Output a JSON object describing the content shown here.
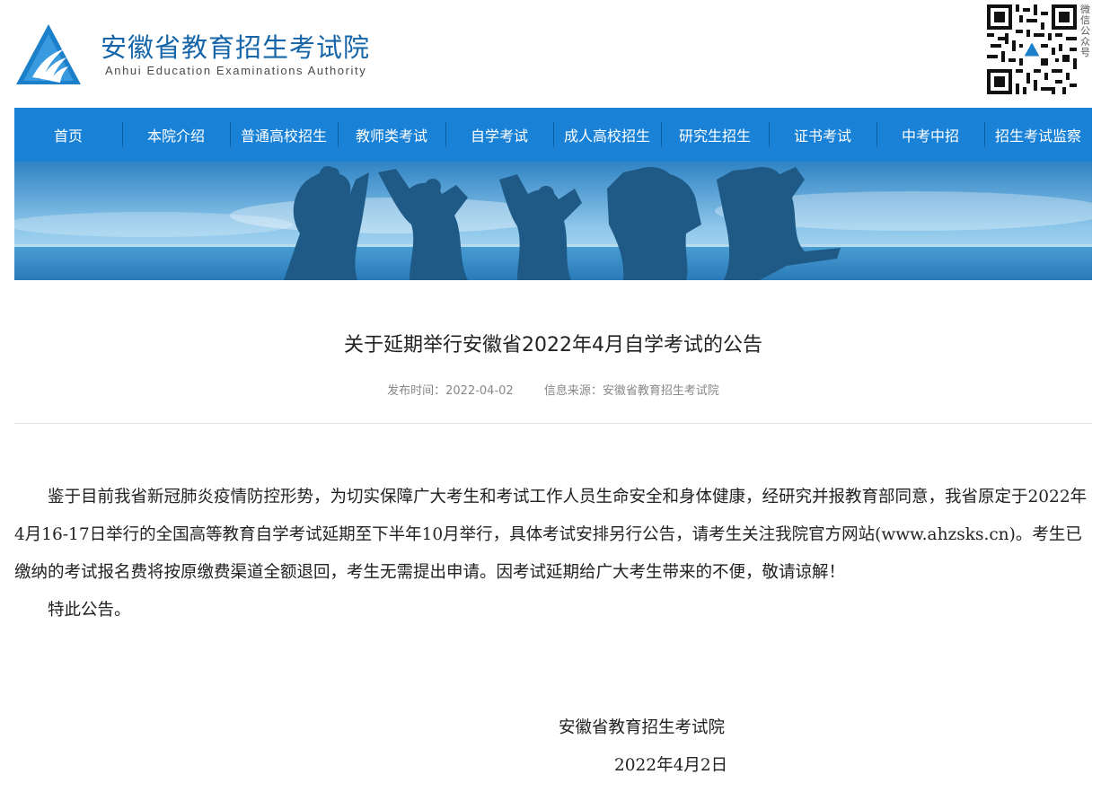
{
  "header": {
    "title": "安徽省教育招生考试院",
    "subtitle": "Anhui Education Examinations Authority",
    "qr_label": "微信公众号"
  },
  "colors": {
    "brand_blue": "#1565a8",
    "nav_blue": "#1a82d6",
    "text": "#222222",
    "meta": "#888888"
  },
  "icons": {
    "logo": "triangle-flame-logo-icon",
    "qr": "wechat-qr-code-icon"
  },
  "nav": {
    "items": [
      {
        "label": "首页"
      },
      {
        "label": "本院介绍"
      },
      {
        "label": "普通高校招生"
      },
      {
        "label": "教师类考试"
      },
      {
        "label": "自学考试"
      },
      {
        "label": "成人高校招生"
      },
      {
        "label": "研究生招生"
      },
      {
        "label": "证书考试"
      },
      {
        "label": "中考中招"
      },
      {
        "label": "招生考试监察"
      }
    ]
  },
  "article": {
    "title": "关于延期举行安徽省2022年4月自学考试的公告",
    "publish_time": "发布时间：2022-04-02",
    "source": "信息来源：安徽省教育招生考试院",
    "paragraph1": "鉴于目前我省新冠肺炎疫情防控形势，为切实保障广大考生和考试工作人员生命安全和身体健康，经研究并报教育部同意，我省原定于2022年4月16-17日举行的全国高等教育自学考试延期至下半年10月举行，具体考试安排另行公告，请考生关注我院官方网站(www.ahzsks.cn)。考生已缴纳的考试报名费将按原缴费渠道全额退回，考生无需提出申请。因考试延期给广大考生带来的不便，敬请谅解！",
    "paragraph2": "特此公告。",
    "signature_org": "安徽省教育招生考试院",
    "signature_date": "2022年4月2日"
  }
}
